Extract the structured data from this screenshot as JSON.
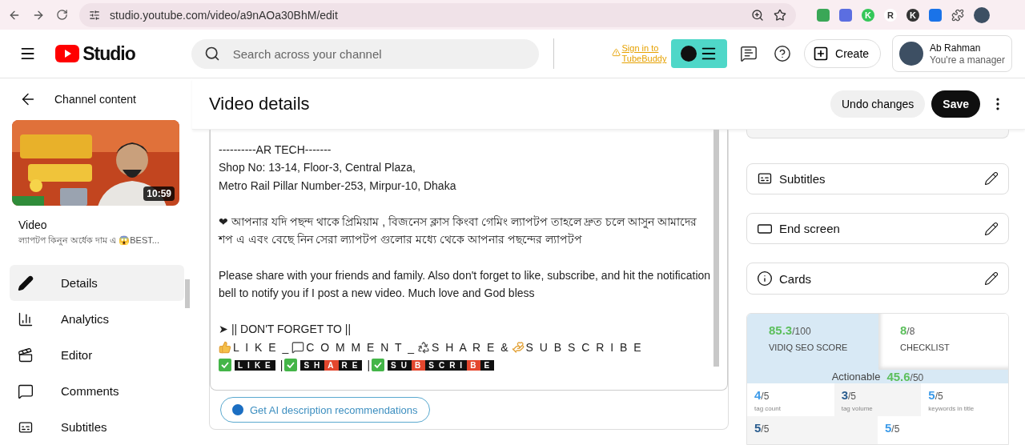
{
  "browser": {
    "url": "studio.youtube.com/video/a9nAOa30BhM/edit",
    "extensions": [
      {
        "kind": "icon",
        "color": "#3aa757"
      },
      {
        "kind": "icon",
        "color": "#5b6ee1"
      },
      {
        "kind": "letter",
        "label": "K",
        "color": "#34c759"
      },
      {
        "kind": "letter",
        "label": "R",
        "color": "#ffffff"
      },
      {
        "kind": "letter",
        "label": "K",
        "color": "#333333"
      },
      {
        "kind": "icon",
        "color": "#1a73e8"
      }
    ]
  },
  "header": {
    "logo": "Studio",
    "search": {
      "placeholder": "Search across your channel"
    },
    "tubebuddy": "Sign in to TubeBuddy",
    "create": "Create",
    "account": {
      "name": "Ab Rahman",
      "role": "You're a manager"
    }
  },
  "sidebar": {
    "back": "Channel content",
    "thumbnail": {
      "duration": "10:59"
    },
    "video_label": "Video",
    "video_title": "ল্যাপটপ কিনুন অর্ধেক দাম এ 😱BEST...",
    "items": [
      {
        "label": "Details",
        "kind": "pencil",
        "selected": true
      },
      {
        "label": "Analytics",
        "kind": "chart",
        "selected": false
      },
      {
        "label": "Editor",
        "kind": "clapper",
        "selected": false
      },
      {
        "label": "Comments",
        "kind": "comment",
        "selected": false
      },
      {
        "label": "Subtitles",
        "kind": "subtitles",
        "selected": false
      }
    ]
  },
  "page": {
    "title": "Video details",
    "undo": "Undo changes",
    "save": "Save"
  },
  "description": {
    "lines": [
      {
        "kind": "text",
        "text": "----------AR TECH-------"
      },
      {
        "kind": "text",
        "text": "Shop No: 13-14, Floor-3, Central Plaza,"
      },
      {
        "kind": "text",
        "text": "Metro Rail Pillar Number-253, Mirpur-10, Dhaka"
      },
      {
        "kind": "blank"
      },
      {
        "kind": "text",
        "text": "❤ আপনার যদি পছন্দ থাকে প্রিমিয়াম , বিজনেস ক্লাস কিংবা গেমিং ল্যাপটপ তাহলে দ্রুত চলে আসুন আমাদের শপ এ এবং বেছে নিন সেরা ল্যাপটপ গুলোর মধ্যে থেকে আপনার পছন্দের ল্যাপটপ"
      },
      {
        "kind": "blank"
      },
      {
        "kind": "text",
        "text": "Please share with your friends and family. Also don't forget to like, subscribe, and hit the notification bell to notify you if I post a new video. Much love and God bless"
      },
      {
        "kind": "blank"
      },
      {
        "kind": "text",
        "text": "➤ || DON'T FORGET TO ||"
      },
      {
        "kind": "emoji",
        "parts": [
          {
            "kind": "thumb",
            "text": "L I K E _"
          },
          {
            "kind": "comment",
            "text": "C O M M E N T _"
          },
          {
            "kind": "recycle",
            "text": "S H A R E &"
          },
          {
            "kind": "hands",
            "text": "S U B S C R I B E"
          }
        ]
      },
      {
        "kind": "boxed",
        "separators": [
          "|",
          "|"
        ],
        "words": [
          [
            {
              "text": "LIKE",
              "highlight": false
            }
          ],
          [
            {
              "text": "SH",
              "highlight": false
            },
            {
              "text": "A",
              "highlight": true
            },
            {
              "text": "RE",
              "highlight": false
            }
          ],
          [
            {
              "text": "SU",
              "highlight": false
            },
            {
              "text": "B",
              "highlight": true
            },
            {
              "text": "SCRI",
              "highlight": false
            },
            {
              "text": "B",
              "highlight": true
            },
            {
              "text": "E",
              "highlight": false
            }
          ]
        ]
      }
    ],
    "ai_button": "Get AI description recommendations"
  },
  "right_cards": [
    {
      "label": "Subtitles",
      "kind": "subtitles"
    },
    {
      "label": "End screen",
      "kind": "endscreen"
    },
    {
      "label": "Cards",
      "kind": "info"
    }
  ],
  "vidiq": {
    "tabs": [
      {
        "score": "85.3",
        "total": "/100",
        "label": "VIDIQ SEO SCORE",
        "selected": true
      },
      {
        "score": "8",
        "total": "/8",
        "label": "CHECKLIST",
        "selected": false
      }
    ],
    "actionable": {
      "label": "Actionable",
      "score": "45.6",
      "total": "/50"
    },
    "metrics": [
      [
        {
          "score": "4",
          "total": "/5",
          "label": "tag count",
          "color": "#3d9be9"
        },
        {
          "score": "3",
          "total": "/5",
          "label": "tag volume",
          "color": "#2a5d8f"
        },
        {
          "score": "5",
          "total": "/5",
          "label": "keywords in title",
          "color": "#3d9be9"
        }
      ],
      [
        {
          "score": "5",
          "total": "/5",
          "color": "#2a5d8f"
        },
        {
          "score": "5",
          "total": "/5",
          "color": "#3d9be9"
        }
      ]
    ]
  }
}
